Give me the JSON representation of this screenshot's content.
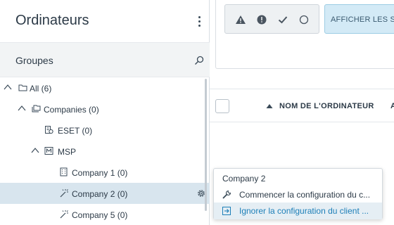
{
  "left_panel": {
    "title": "Ordinateurs",
    "groups_label": "Groupes"
  },
  "tree": [
    {
      "label": "All (6)",
      "icon": "folder-icon",
      "expanded": true
    },
    {
      "label": "Companies (0)",
      "icon": "group-folder-icon",
      "expanded": true
    },
    {
      "label": "ESET (0)",
      "icon": "company-badge-icon",
      "expanded": false
    },
    {
      "label": "MSP",
      "icon": "msp-icon",
      "expanded": true
    },
    {
      "label": "Company 1 (0)",
      "icon": "building-icon",
      "expanded": false
    },
    {
      "label": "Company 2 (0)",
      "icon": "magic-wand-icon",
      "expanded": false,
      "selected": true
    },
    {
      "label": "Company 5 (0)",
      "icon": "magic-wand-icon",
      "expanded": false
    }
  ],
  "filters": {
    "status_icons": [
      "warning-icon",
      "error-icon",
      "check-icon",
      "circle-icon"
    ],
    "show_button": "AFFICHER LES SOUS"
  },
  "table": {
    "col_name": "NOM DE L'ORDINATEUR",
    "col_next": "A"
  },
  "context_menu": {
    "title": "Company 2",
    "items": [
      {
        "label": "Commencer la configuration du c...",
        "icon": "wrench-icon"
      },
      {
        "label": "Ignorer la configuration du client ...",
        "icon": "skip-icon",
        "highlighted": true
      }
    ]
  },
  "colors": {
    "selected_row": "#d8e5ee",
    "accent": "#1d7fb8",
    "show_button_bg": "#d3eaf6"
  }
}
